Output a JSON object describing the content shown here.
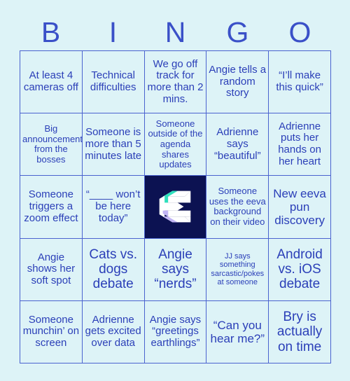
{
  "card": {
    "title": "BINGO",
    "header_letters": [
      "B",
      "I",
      "N",
      "G",
      "O"
    ],
    "colors": {
      "background": "#ddf3f7",
      "cell_fill": "#ddf3f7",
      "grid_line": "#4a62cf",
      "text": "#2b3fb8",
      "header_text": "#3a50c8",
      "free_space_background": "#0c1252",
      "logo_white": "#ffffff",
      "logo_teal": "#2ee0bd",
      "logo_lavender": "#c2b5f5"
    },
    "rows": [
      [
        {
          "text": "At least 4 cameras off",
          "size": "md",
          "type": "square"
        },
        {
          "text": "Technical difficulties",
          "size": "md",
          "type": "square"
        },
        {
          "text": "We go off track for more than 2 mins.",
          "size": "md",
          "type": "square"
        },
        {
          "text": "Angie tells a random story",
          "size": "md",
          "type": "square"
        },
        {
          "text": "“I’ll make this quick”",
          "size": "md",
          "type": "square"
        }
      ],
      [
        {
          "text": "Big announcement from the bosses",
          "size": "sm",
          "type": "square"
        },
        {
          "text": "Someone is more than 5 minutes late",
          "size": "md",
          "type": "square"
        },
        {
          "text": "Someone outside of the agenda shares updates",
          "size": "sm",
          "type": "square"
        },
        {
          "text": "Adrienne says “beautiful”",
          "size": "md",
          "type": "square"
        },
        {
          "text": "Adrienne puts her hands on her heart",
          "size": "md",
          "type": "square"
        }
      ],
      [
        {
          "text": "Someone triggers a zoom effect",
          "size": "md",
          "type": "square"
        },
        {
          "text": "“____ won’t be here today”",
          "size": "md",
          "type": "square"
        },
        {
          "text": "",
          "size": "md",
          "type": "free-space",
          "icon": "eeva-logo"
        },
        {
          "text": "Someone uses the eeva background on their video",
          "size": "sm",
          "type": "square"
        },
        {
          "text": "New eeva pun discovery",
          "size": "lg",
          "type": "square"
        }
      ],
      [
        {
          "text": "Angie shows her soft spot",
          "size": "md",
          "type": "square"
        },
        {
          "text": "Cats vs. dogs debate",
          "size": "xl",
          "type": "square"
        },
        {
          "text": "Angie says “nerds”",
          "size": "xl",
          "type": "square"
        },
        {
          "text": "JJ says something sarcastic/pokes at someone",
          "size": "xs",
          "type": "square"
        },
        {
          "text": "Android vs. iOS debate",
          "size": "xl",
          "type": "square"
        }
      ],
      [
        {
          "text": "Someone munchin’ on screen",
          "size": "md",
          "type": "square"
        },
        {
          "text": "Adrienne gets excited over data",
          "size": "md",
          "type": "square"
        },
        {
          "text": "Angie says “greetings earthlings”",
          "size": "md",
          "type": "square"
        },
        {
          "text": "“Can you hear me?”",
          "size": "lg",
          "type": "square"
        },
        {
          "text": "Bry is actually on time",
          "size": "xl",
          "type": "square"
        }
      ]
    ]
  }
}
